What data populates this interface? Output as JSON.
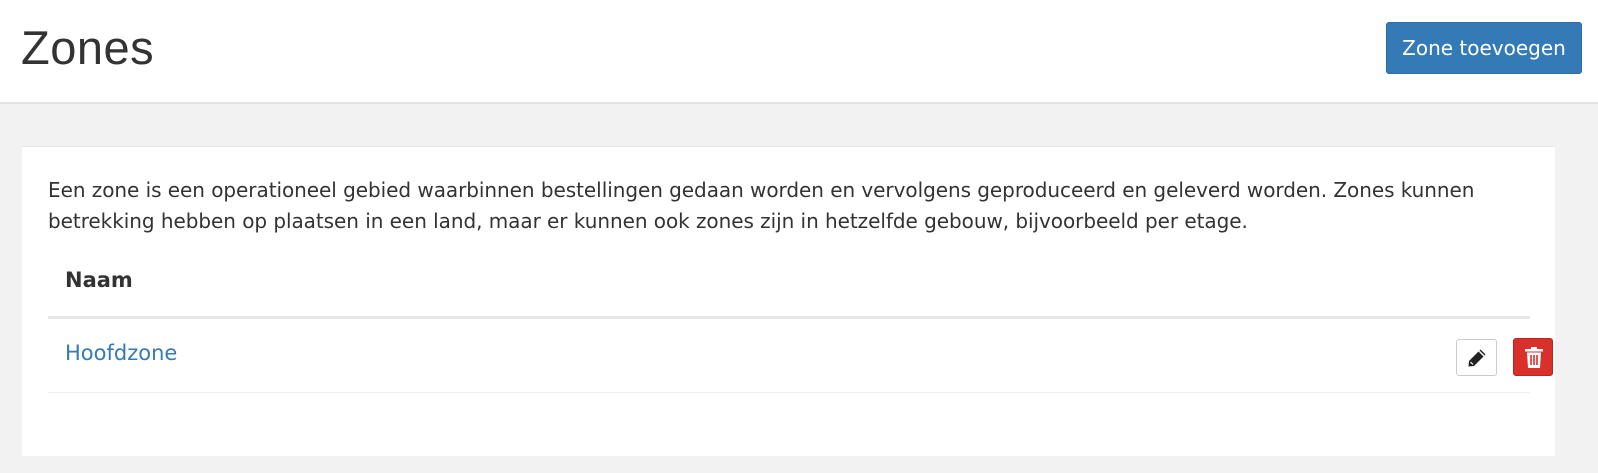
{
  "header": {
    "title": "Zones",
    "add_button_label": "Zone toevoegen"
  },
  "main": {
    "description": "Een zone is een operationeel gebied waarbinnen bestellingen gedaan worden en vervolgens geproduceerd en geleverd worden. Zones kunnen betrekking hebben op plaatsen in een land, maar er kunnen ook zones zijn in hetzelfde gebouw, bijvoorbeeld per etage.",
    "table": {
      "columns": [
        "Naam"
      ],
      "rows": [
        {
          "name": "Hoofdzone",
          "actions": [
            "pencil-icon",
            "trash-icon"
          ]
        }
      ]
    }
  },
  "colors": {
    "primary": "#337ab7",
    "danger": "#d9302c",
    "background": "#f2f2f2"
  }
}
